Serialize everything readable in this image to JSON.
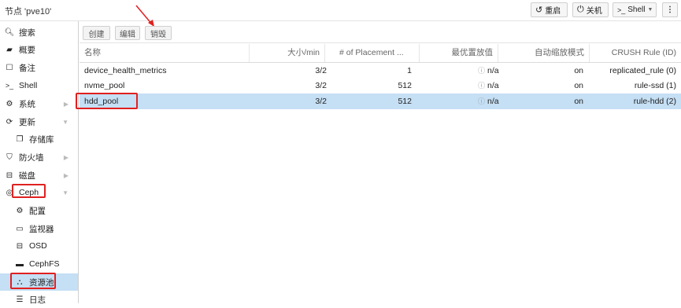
{
  "header": {
    "title": "节点 'pve10'",
    "reboot_label": "重启",
    "shutdown_label": "关机",
    "shell_label": "Shell"
  },
  "sidebar": {
    "items": [
      {
        "label": "搜索",
        "icon": "search-icon"
      },
      {
        "label": "概要",
        "icon": "book-icon"
      },
      {
        "label": "备注",
        "icon": "note-icon"
      },
      {
        "label": "Shell",
        "icon": "terminal-icon"
      },
      {
        "label": "系统",
        "icon": "gears-icon"
      },
      {
        "label": "更新",
        "icon": "refresh-icon"
      },
      {
        "label": "存储库",
        "icon": "copy-icon"
      },
      {
        "label": "防火墙",
        "icon": "shield-icon"
      },
      {
        "label": "磁盘",
        "icon": "hdd-icon"
      },
      {
        "label": "Ceph",
        "icon": "ceph-icon"
      },
      {
        "label": "配置",
        "icon": "gear-icon"
      },
      {
        "label": "监视器",
        "icon": "monitor-icon"
      },
      {
        "label": "OSD",
        "icon": "hdd-icon"
      },
      {
        "label": "CephFS",
        "icon": "folder-icon"
      },
      {
        "label": "资源池",
        "icon": "sitemap-icon"
      },
      {
        "label": "日志",
        "icon": "list-icon"
      }
    ]
  },
  "toolbar": {
    "create_label": "创建",
    "edit_label": "编辑",
    "destroy_label": "销毁"
  },
  "table": {
    "columns": [
      "名称",
      "大小/min",
      "# of Placement ...",
      "最优置放值",
      "自动缩放模式",
      "CRUSH Rule (ID)"
    ],
    "rows": [
      {
        "name": "device_health_metrics",
        "size": "3/2",
        "pgs": "1",
        "optimal": "n/a",
        "autoscale": "on",
        "crush": "replicated_rule (0)"
      },
      {
        "name": "nvme_pool",
        "size": "3/2",
        "pgs": "512",
        "optimal": "n/a",
        "autoscale": "on",
        "crush": "rule-ssd (1)"
      },
      {
        "name": "hdd_pool",
        "size": "3/2",
        "pgs": "512",
        "optimal": "n/a",
        "autoscale": "on",
        "crush": "rule-hdd (2)"
      }
    ]
  },
  "colors": {
    "selected": "#c5dff4",
    "highlight": "#e02020"
  }
}
